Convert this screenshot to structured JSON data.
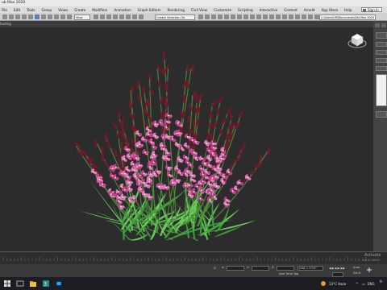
{
  "title": "ub Max 2020",
  "menu": [
    "File",
    "Edit",
    "Tools",
    "Group",
    "Views",
    "Create",
    "Modifiers",
    "Animation",
    "Graph Editors",
    "Rendering",
    "Civil View",
    "Customize",
    "Scripting",
    "Interactive",
    "Content",
    "Arnold",
    "App Store",
    "Help"
  ],
  "signin_label": "Sign In",
  "toolbar": {
    "view_select": "View",
    "selection_set": "Create Selection Se",
    "path": "C:\\Users\\VM\\Documents\\3ds Max 2020"
  },
  "viewport_label": "hading",
  "status": {
    "x_field": "",
    "add_time_tag": "Add Time Tag",
    "grid_field": "Grid = 0'10\"",
    "auto_label": "Auto",
    "set_k_label": "Set K"
  },
  "watermark": {
    "line1": "Activate",
    "line2": "Go to Settin"
  },
  "tray": {
    "weather": "13°C  Haze",
    "lang": "ENG",
    "time": "9:"
  },
  "colors": {
    "petal_main": "#c0408a",
    "petal_light": "#e07cb6",
    "bud_dark": "#6e1a2c",
    "leaf": "#3fa33a",
    "leaf_light": "#6fd060"
  }
}
